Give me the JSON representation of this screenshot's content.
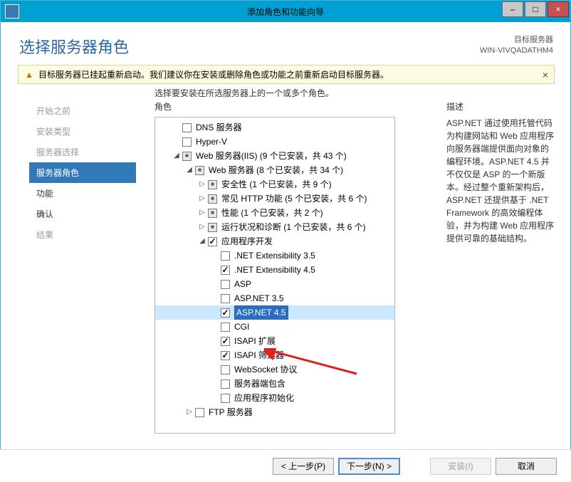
{
  "window": {
    "title": "添加角色和功能向导",
    "minimize": "–",
    "maximize": "□",
    "close": "×"
  },
  "header": {
    "page_title": "选择服务器角色",
    "dest_label": "目标服务器",
    "dest_server": "WIN-VIVQADATHM4"
  },
  "warning": {
    "text": "目标服务器已挂起重新启动。我们建议你在安装或删除角色或功能之前重新启动目标服务器。",
    "close": "×"
  },
  "sub_instruction": "选择要安装在所选服务器上的一个或多个角色。",
  "sidebar": {
    "items": [
      {
        "label": "开始之前",
        "disabled": true
      },
      {
        "label": "安装类型",
        "disabled": true
      },
      {
        "label": "服务器选择",
        "disabled": true
      },
      {
        "label": "服务器角色",
        "active": true
      },
      {
        "label": "功能"
      },
      {
        "label": "确认"
      },
      {
        "label": "结果",
        "disabled": true
      }
    ]
  },
  "roles": {
    "caption": "角色",
    "tree": [
      {
        "indent": 1,
        "exp": "",
        "chk": "unchecked",
        "label": "DNS 服务器"
      },
      {
        "indent": 1,
        "exp": "",
        "chk": "unchecked",
        "label": "Hyper-V"
      },
      {
        "indent": 1,
        "exp": "open",
        "chk": "indet",
        "label": "Web 服务器(IIS) (9 个已安装，共 43 个)"
      },
      {
        "indent": 2,
        "exp": "open",
        "chk": "indet",
        "label": "Web 服务器 (8 个已安装，共 34 个)"
      },
      {
        "indent": 3,
        "exp": "closed",
        "chk": "indet",
        "label": "安全性 (1 个已安装，共 9 个)"
      },
      {
        "indent": 3,
        "exp": "closed",
        "chk": "indet",
        "label": "常见 HTTP 功能 (5 个已安装，共 6 个)"
      },
      {
        "indent": 3,
        "exp": "closed",
        "chk": "indet",
        "label": "性能 (1 个已安装，共 2 个)"
      },
      {
        "indent": 3,
        "exp": "closed",
        "chk": "indet",
        "label": "运行状况和诊断 (1 个已安装，共 6 个)"
      },
      {
        "indent": 3,
        "exp": "open",
        "chk": "checked",
        "label": "应用程序开发"
      },
      {
        "indent": 4,
        "exp": "",
        "chk": "unchecked",
        "label": ".NET Extensibility 3.5"
      },
      {
        "indent": 4,
        "exp": "",
        "chk": "checked",
        "label": ".NET Extensibility 4.5"
      },
      {
        "indent": 4,
        "exp": "",
        "chk": "unchecked",
        "label": "ASP"
      },
      {
        "indent": 4,
        "exp": "",
        "chk": "unchecked",
        "label": "ASP.NET 3.5"
      },
      {
        "indent": 4,
        "exp": "",
        "chk": "checked",
        "label": "ASP.NET 4.5",
        "selected": true
      },
      {
        "indent": 4,
        "exp": "",
        "chk": "unchecked",
        "label": "CGI"
      },
      {
        "indent": 4,
        "exp": "",
        "chk": "checked",
        "label": "ISAPI 扩展"
      },
      {
        "indent": 4,
        "exp": "",
        "chk": "checked",
        "label": "ISAPI 筛选器"
      },
      {
        "indent": 4,
        "exp": "",
        "chk": "unchecked",
        "label": "WebSocket 协议"
      },
      {
        "indent": 4,
        "exp": "",
        "chk": "unchecked",
        "label": "服务器端包含"
      },
      {
        "indent": 4,
        "exp": "",
        "chk": "unchecked",
        "label": "应用程序初始化"
      },
      {
        "indent": 2,
        "exp": "closed",
        "chk": "unchecked",
        "label": "FTP 服务器"
      }
    ]
  },
  "description": {
    "caption": "描述",
    "text": "ASP.NET 通过使用托管代码为构建网站和 Web 应用程序向服务器端提供面向对象的编程环境。ASP.NET 4.5 并不仅仅是 ASP 的一个新版本。经过整个重新架构后，ASP.NET 还提供基于 .NET Framework 的高效编程体验，并为构建 Web 应用程序提供可靠的基础结构。"
  },
  "footer": {
    "prev": "< 上一步(P)",
    "next": "下一步(N) >",
    "install": "安装(I)",
    "cancel": "取消"
  }
}
